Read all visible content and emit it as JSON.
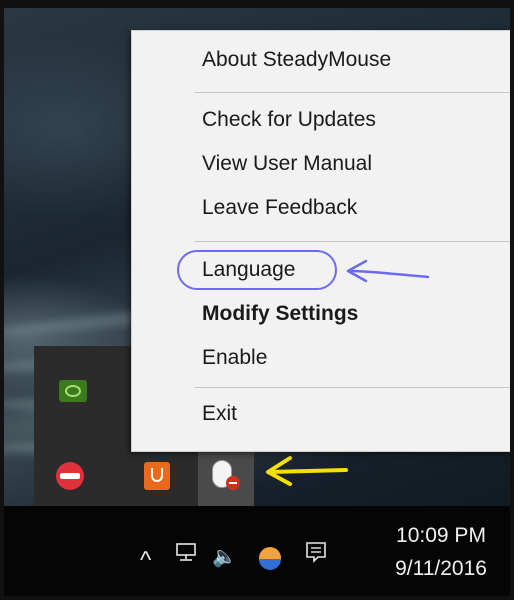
{
  "context_menu": {
    "items": {
      "about": "About SteadyMouse",
      "check_updates": "Check for Updates",
      "user_manual": "View User Manual",
      "feedback": "Leave Feedback",
      "language": "Language",
      "modify_settings": "Modify Settings",
      "enable": "Enable",
      "exit": "Exit"
    },
    "highlight_color": "#6b6bf0"
  },
  "tray_overflow": {
    "icons": [
      "nvidia-icon",
      "no-entry-icon",
      "java-icon",
      "steadymouse-icon"
    ]
  },
  "annotation_arrows": {
    "language_arrow_color": "#6b6bf0",
    "tray_arrow_color": "#f5e000"
  },
  "taskbar": {
    "tray_icons": [
      "chevron-up-icon",
      "network-icon",
      "volume-icon",
      "onedrive-icon",
      "notification-icon"
    ],
    "chevron": "^",
    "volume": "🔈",
    "clock": {
      "time": "10:09 PM",
      "date": "9/11/2016"
    }
  }
}
